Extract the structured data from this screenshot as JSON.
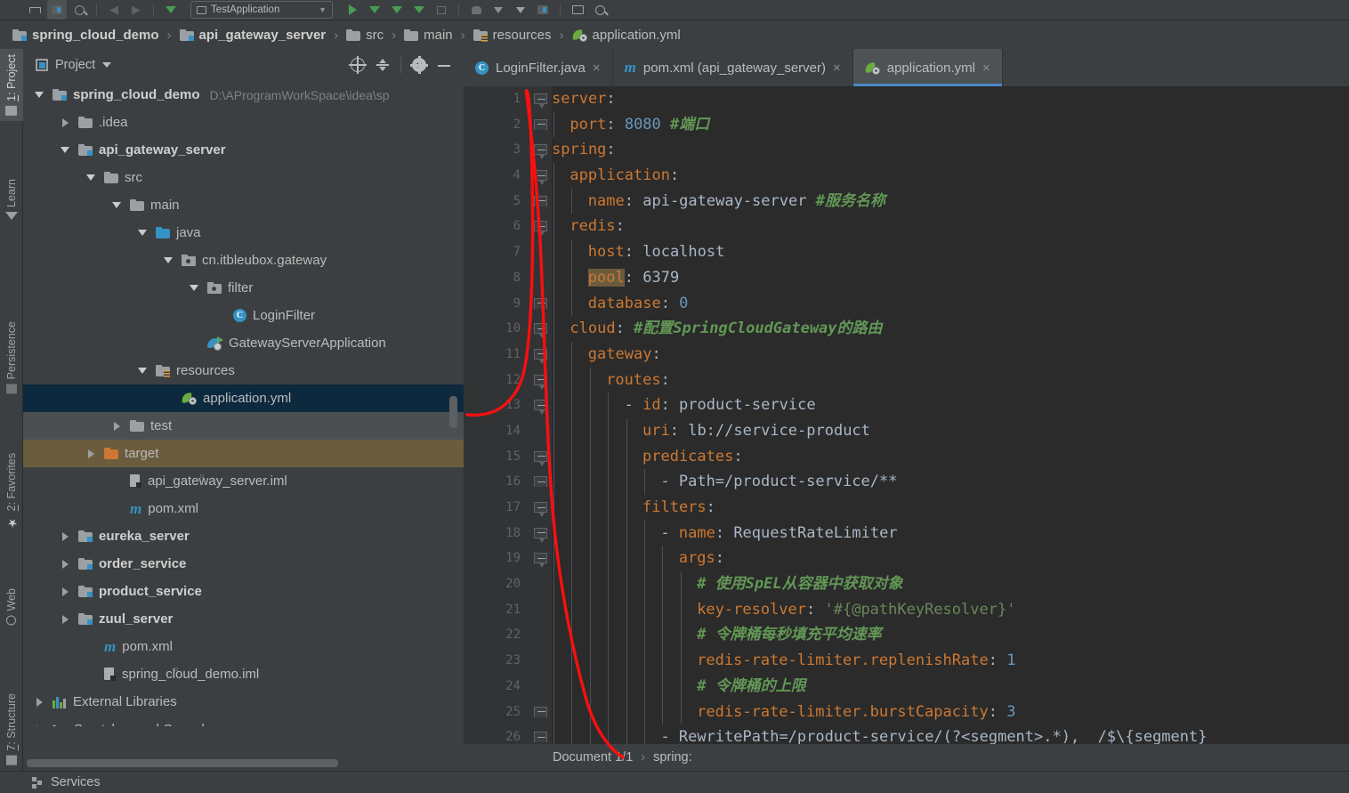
{
  "toolbar": {
    "run_config": "TestApplication",
    "icons": [
      "save-all-icon",
      "project-structure-icon",
      "sync-icon",
      "back-icon",
      "forward-icon",
      "run-anything-icon",
      "run-icon",
      "debug-icon",
      "coverage-icon",
      "profile-icon",
      "stop-icon",
      "build-icon",
      "more-icon",
      "check-icon",
      "db-icon",
      "layout-icon",
      "search-icon"
    ]
  },
  "breadcrumb": {
    "items": [
      {
        "label": "spring_cloud_demo",
        "icon": "module-folder-icon",
        "bold": true
      },
      {
        "label": "api_gateway_server",
        "icon": "module-folder-icon",
        "bold": true
      },
      {
        "label": "src",
        "icon": "folder-icon",
        "bold": false
      },
      {
        "label": "main",
        "icon": "folder-icon",
        "bold": false
      },
      {
        "label": "resources",
        "icon": "resources-folder-icon",
        "bold": false
      },
      {
        "label": "application.yml",
        "icon": "spring-yml-icon",
        "bold": false
      }
    ],
    "separator": "›"
  },
  "left_strip": {
    "items": [
      {
        "label": "1: Project",
        "mnemonic": "1",
        "icon": "project-icon",
        "active": true
      },
      {
        "label": "Learn",
        "icon": "learn-icon",
        "active": false
      },
      {
        "label": "Persistence",
        "icon": "persistence-icon",
        "active": false
      },
      {
        "label": "2: Favorites",
        "mnemonic": "2",
        "icon": "star-icon",
        "active": false
      },
      {
        "label": "Web",
        "icon": "web-icon",
        "active": false
      },
      {
        "label": "7: Structure",
        "mnemonic": "7",
        "icon": "structure-icon",
        "active": false
      }
    ]
  },
  "project_panel": {
    "title": "Project",
    "actions": [
      "locate-icon",
      "collapse-all-icon",
      "settings-gear-icon",
      "hide-icon"
    ],
    "tree": [
      {
        "label": "spring_cloud_demo",
        "path": "D:\\AProgramWorkSpace\\idea\\sp",
        "indent": 0,
        "arrow": "down",
        "icon": "module-folder-icon",
        "bold": true,
        "state": "none"
      },
      {
        "label": ".idea",
        "path": "",
        "indent": 1,
        "arrow": "right",
        "icon": "folder-icon",
        "bold": false,
        "state": "none"
      },
      {
        "label": "api_gateway_server",
        "path": "",
        "indent": 1,
        "arrow": "down",
        "icon": "module-folder-icon",
        "bold": true,
        "state": "none"
      },
      {
        "label": "src",
        "path": "",
        "indent": 2,
        "arrow": "down",
        "icon": "folder-icon",
        "bold": false,
        "state": "none"
      },
      {
        "label": "main",
        "path": "",
        "indent": 3,
        "arrow": "down",
        "icon": "folder-icon",
        "bold": false,
        "state": "none"
      },
      {
        "label": "java",
        "path": "",
        "indent": 4,
        "arrow": "down",
        "icon": "source-folder-icon",
        "bold": false,
        "state": "none"
      },
      {
        "label": "cn.itbleubox.gateway",
        "path": "",
        "indent": 5,
        "arrow": "down",
        "icon": "package-icon",
        "bold": false,
        "state": "none"
      },
      {
        "label": "filter",
        "path": "",
        "indent": 6,
        "arrow": "down",
        "icon": "package-icon",
        "bold": false,
        "state": "none"
      },
      {
        "label": "LoginFilter",
        "path": "",
        "indent": 7,
        "arrow": "none",
        "icon": "java-class-icon",
        "bold": false,
        "state": "none"
      },
      {
        "label": "GatewayServerApplication",
        "path": "",
        "indent": 6,
        "arrow": "none",
        "icon": "spring-run-class-icon",
        "bold": false,
        "state": "none"
      },
      {
        "label": "resources",
        "path": "",
        "indent": 4,
        "arrow": "down",
        "icon": "resources-folder-icon",
        "bold": false,
        "state": "none"
      },
      {
        "label": "application.yml",
        "path": "",
        "indent": 5,
        "arrow": "none",
        "icon": "spring-yml-icon",
        "bold": false,
        "state": "selected"
      },
      {
        "label": "test",
        "path": "",
        "indent": 3,
        "arrow": "right",
        "icon": "folder-icon",
        "bold": false,
        "state": "hover"
      },
      {
        "label": "target",
        "path": "",
        "indent": 2,
        "arrow": "right",
        "icon": "excluded-folder-icon",
        "bold": false,
        "state": "target"
      },
      {
        "label": "api_gateway_server.iml",
        "path": "",
        "indent": 3,
        "arrow": "none",
        "icon": "iml-file-icon",
        "bold": false,
        "state": "none"
      },
      {
        "label": "pom.xml",
        "path": "",
        "indent": 3,
        "arrow": "none",
        "icon": "maven-icon",
        "bold": false,
        "state": "none"
      },
      {
        "label": "eureka_server",
        "path": "",
        "indent": 1,
        "arrow": "right",
        "icon": "module-folder-icon",
        "bold": true,
        "state": "none"
      },
      {
        "label": "order_service",
        "path": "",
        "indent": 1,
        "arrow": "right",
        "icon": "module-folder-icon",
        "bold": true,
        "state": "none"
      },
      {
        "label": "product_service",
        "path": "",
        "indent": 1,
        "arrow": "right",
        "icon": "module-folder-icon",
        "bold": true,
        "state": "none"
      },
      {
        "label": "zuul_server",
        "path": "",
        "indent": 1,
        "arrow": "right",
        "icon": "module-folder-icon",
        "bold": true,
        "state": "none"
      },
      {
        "label": "pom.xml",
        "path": "",
        "indent": 2,
        "arrow": "none",
        "icon": "maven-icon",
        "bold": false,
        "state": "none"
      },
      {
        "label": "spring_cloud_demo.iml",
        "path": "",
        "indent": 2,
        "arrow": "none",
        "icon": "iml-file-icon",
        "bold": false,
        "state": "none"
      },
      {
        "label": "External Libraries",
        "path": "",
        "indent": 0,
        "arrow": "right",
        "icon": "libraries-icon",
        "bold": false,
        "state": "none"
      },
      {
        "label": "Scratches and Consoles",
        "path": "",
        "indent": 0,
        "arrow": "right",
        "icon": "scratches-icon",
        "bold": false,
        "state": "none"
      }
    ]
  },
  "editor": {
    "tabs": [
      {
        "label": "LoginFilter.java",
        "icon": "java-class-icon",
        "active": false,
        "close": "×"
      },
      {
        "label": "pom.xml (api_gateway_server)",
        "icon": "maven-icon",
        "active": false,
        "close": "×"
      },
      {
        "label": "application.yml",
        "icon": "spring-yml-icon",
        "active": true,
        "close": "×"
      }
    ],
    "status": {
      "document": "Document 1/1",
      "separator": "›",
      "breadcrumb": "spring:"
    },
    "lines": [
      {
        "num": "1",
        "indent": 0,
        "tokens": [
          {
            "t": "server",
            "c": "k"
          },
          {
            "t": ":",
            "c": "v"
          }
        ],
        "fold": "open"
      },
      {
        "num": "2",
        "indent": 1,
        "tokens": [
          {
            "t": "port",
            "c": "k"
          },
          {
            "t": ": ",
            "c": "v"
          },
          {
            "t": "8080",
            "c": "n"
          },
          {
            "t": " ",
            "c": "v"
          },
          {
            "t": "#端口",
            "c": "cmb"
          }
        ],
        "fold": "end"
      },
      {
        "num": "3",
        "indent": 0,
        "tokens": [
          {
            "t": "spring",
            "c": "k"
          },
          {
            "t": ":",
            "c": "v"
          }
        ],
        "fold": "open"
      },
      {
        "num": "4",
        "indent": 1,
        "tokens": [
          {
            "t": "application",
            "c": "k"
          },
          {
            "t": ":",
            "c": "v"
          }
        ],
        "fold": "open"
      },
      {
        "num": "5",
        "indent": 2,
        "tokens": [
          {
            "t": "name",
            "c": "k"
          },
          {
            "t": ": ",
            "c": "v"
          },
          {
            "t": "api-gateway-server",
            "c": "v"
          },
          {
            "t": " ",
            "c": "v"
          },
          {
            "t": "#服务名称",
            "c": "cmb"
          }
        ],
        "fold": "end"
      },
      {
        "num": "6",
        "indent": 1,
        "tokens": [
          {
            "t": "redis",
            "c": "k"
          },
          {
            "t": ":",
            "c": "v"
          }
        ],
        "fold": "open"
      },
      {
        "num": "7",
        "indent": 2,
        "tokens": [
          {
            "t": "host",
            "c": "k"
          },
          {
            "t": ": ",
            "c": "v"
          },
          {
            "t": "localhost",
            "c": "v"
          }
        ],
        "fold": "none"
      },
      {
        "num": "8",
        "indent": 2,
        "tokens": [
          {
            "t": "pool",
            "c": "k hl"
          },
          {
            "t": ": ",
            "c": "v"
          },
          {
            "t": "6379",
            "c": "v"
          }
        ],
        "fold": "none"
      },
      {
        "num": "9",
        "indent": 2,
        "tokens": [
          {
            "t": "database",
            "c": "k"
          },
          {
            "t": ": ",
            "c": "v"
          },
          {
            "t": "0",
            "c": "n"
          }
        ],
        "fold": "end"
      },
      {
        "num": "10",
        "indent": 1,
        "tokens": [
          {
            "t": "cloud",
            "c": "k"
          },
          {
            "t": ": ",
            "c": "v"
          },
          {
            "t": "#配置SpringCloudGateway的路由",
            "c": "cmb"
          }
        ],
        "fold": "open"
      },
      {
        "num": "11",
        "indent": 2,
        "tokens": [
          {
            "t": "gateway",
            "c": "k"
          },
          {
            "t": ":",
            "c": "v"
          }
        ],
        "fold": "open"
      },
      {
        "num": "12",
        "indent": 3,
        "tokens": [
          {
            "t": "routes",
            "c": "k"
          },
          {
            "t": ":",
            "c": "v"
          }
        ],
        "fold": "open"
      },
      {
        "num": "13",
        "indent": 4,
        "tokens": [
          {
            "t": "- ",
            "c": "v"
          },
          {
            "t": "id",
            "c": "k"
          },
          {
            "t": ": ",
            "c": "v"
          },
          {
            "t": "product-service",
            "c": "v"
          }
        ],
        "fold": "open"
      },
      {
        "num": "14",
        "indent": 5,
        "tokens": [
          {
            "t": "uri",
            "c": "k"
          },
          {
            "t": ": ",
            "c": "v"
          },
          {
            "t": "lb://service-product",
            "c": "v"
          }
        ],
        "fold": "none"
      },
      {
        "num": "15",
        "indent": 5,
        "tokens": [
          {
            "t": "predicates",
            "c": "k"
          },
          {
            "t": ":",
            "c": "v"
          }
        ],
        "fold": "open"
      },
      {
        "num": "16",
        "indent": 6,
        "tokens": [
          {
            "t": "- Path=/product-service/**",
            "c": "v"
          }
        ],
        "fold": "end"
      },
      {
        "num": "17",
        "indent": 5,
        "tokens": [
          {
            "t": "filters",
            "c": "k"
          },
          {
            "t": ":",
            "c": "v"
          }
        ],
        "fold": "open"
      },
      {
        "num": "18",
        "indent": 6,
        "tokens": [
          {
            "t": "- ",
            "c": "v"
          },
          {
            "t": "name",
            "c": "k"
          },
          {
            "t": ": ",
            "c": "v"
          },
          {
            "t": "RequestRateLimiter",
            "c": "v"
          }
        ],
        "fold": "open"
      },
      {
        "num": "19",
        "indent": 7,
        "tokens": [
          {
            "t": "args",
            "c": "k"
          },
          {
            "t": ":",
            "c": "v"
          }
        ],
        "fold": "open"
      },
      {
        "num": "20",
        "indent": 8,
        "tokens": [
          {
            "t": "# 使用SpEL从容器中获取对象",
            "c": "cmb"
          }
        ],
        "fold": "none"
      },
      {
        "num": "21",
        "indent": 8,
        "tokens": [
          {
            "t": "key-resolver",
            "c": "k"
          },
          {
            "t": ": ",
            "c": "v"
          },
          {
            "t": "'#{@pathKeyResolver}'",
            "c": "s"
          }
        ],
        "fold": "none"
      },
      {
        "num": "22",
        "indent": 8,
        "tokens": [
          {
            "t": "# 令牌桶每秒填充平均速率",
            "c": "cmb"
          }
        ],
        "fold": "none"
      },
      {
        "num": "23",
        "indent": 8,
        "tokens": [
          {
            "t": "redis-rate-limiter.replenishRate",
            "c": "k"
          },
          {
            "t": ": ",
            "c": "v"
          },
          {
            "t": "1",
            "c": "n"
          }
        ],
        "fold": "none"
      },
      {
        "num": "24",
        "indent": 8,
        "tokens": [
          {
            "t": "# 令牌桶的上限",
            "c": "cmb"
          }
        ],
        "fold": "none"
      },
      {
        "num": "25",
        "indent": 8,
        "tokens": [
          {
            "t": "redis-rate-limiter.burstCapacity",
            "c": "k"
          },
          {
            "t": ": ",
            "c": "v"
          },
          {
            "t": "3",
            "c": "n"
          }
        ],
        "fold": "end"
      },
      {
        "num": "26",
        "indent": 6,
        "tokens": [
          {
            "t": "- RewritePath=/product-service/(?<segment>.*),  /$\\{segment}",
            "c": "v"
          }
        ],
        "fold": "end"
      }
    ]
  },
  "bottom_bar": {
    "label": "Services",
    "icon": "services-icon"
  },
  "colors": {
    "bg_panel": "#3c3f41",
    "bg_editor": "#2b2b2b",
    "gutter": "#313335",
    "selection": "#0d293e",
    "hover": "#4b4f51",
    "target_highlight": "#6b5c3e",
    "accent_blue": "#4a88c7",
    "keyword_orange": "#cc7832",
    "comment_green": "#629755",
    "string_green": "#6a8759",
    "number_blue": "#6897bb",
    "text": "#a9b7c6",
    "annotation_red": "#fa0f0f"
  }
}
